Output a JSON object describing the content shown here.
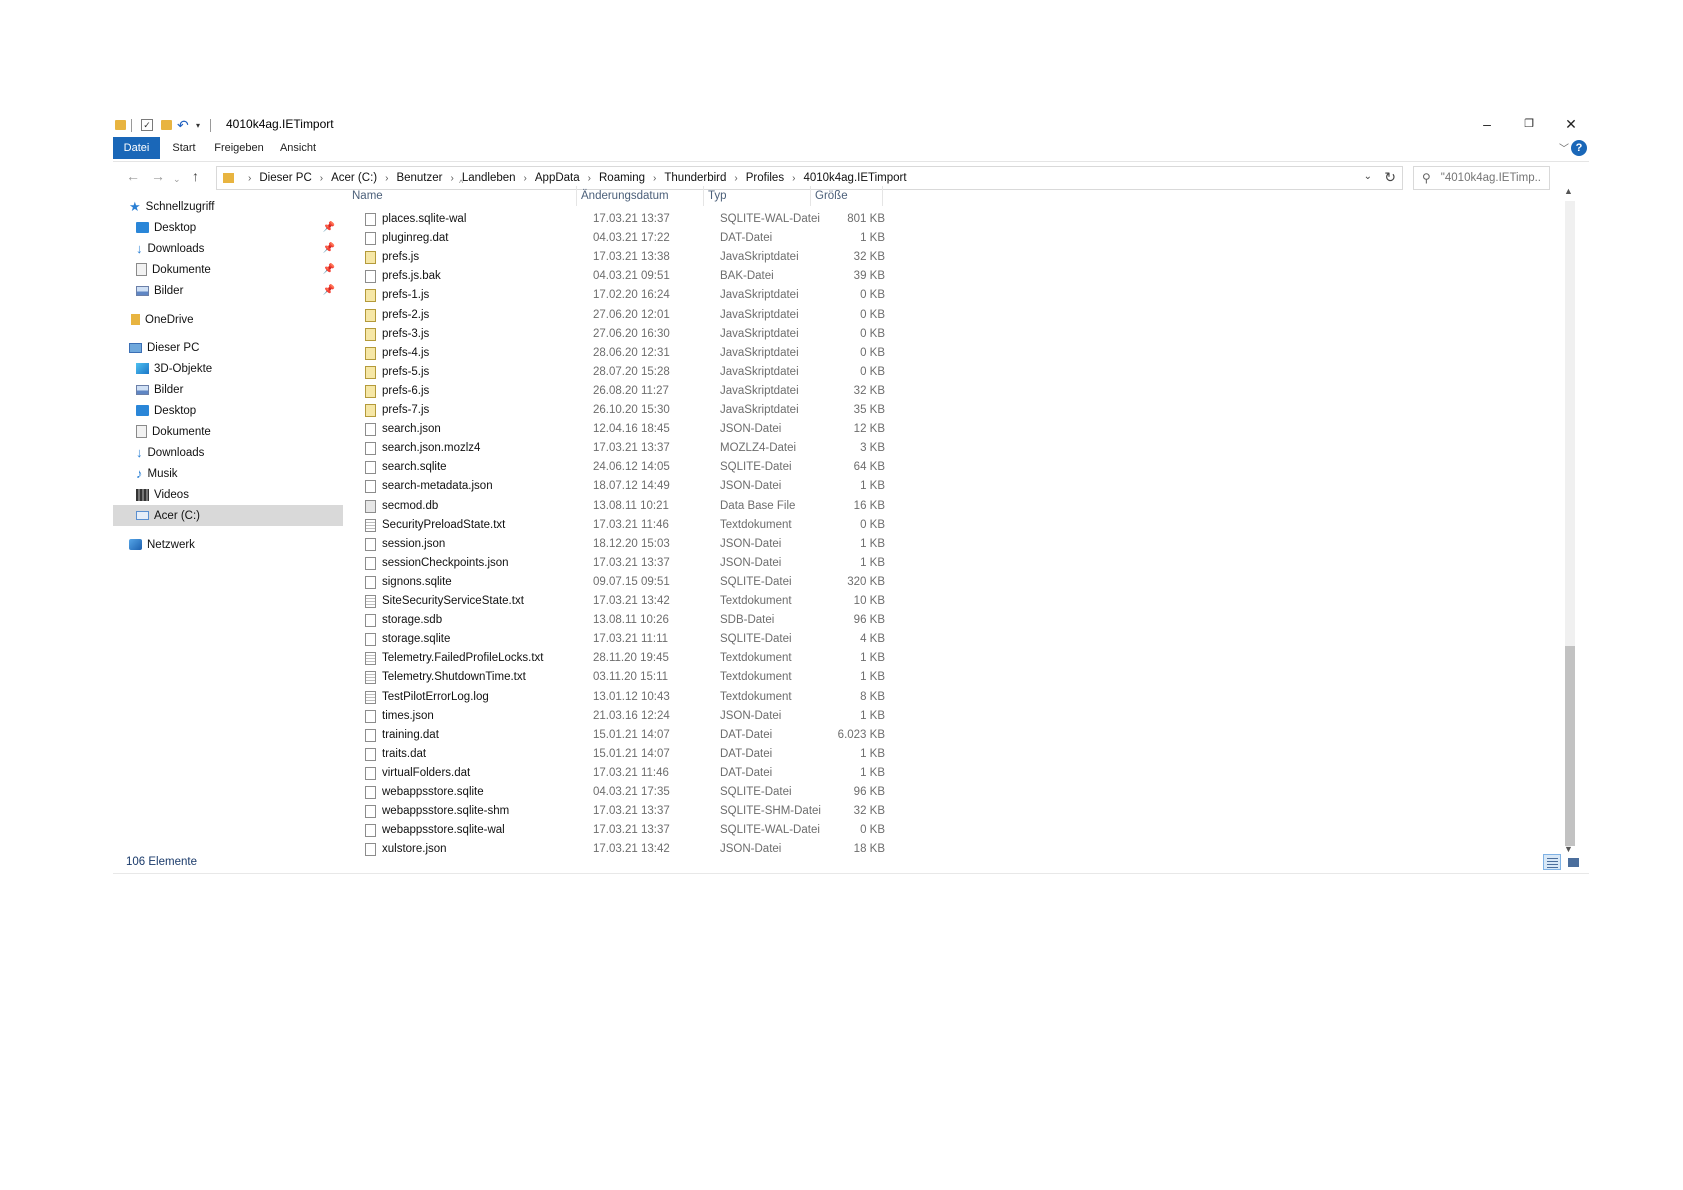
{
  "window": {
    "title": "4010k4ag.IETimport",
    "minimize_glyph": "–",
    "restore_glyph": "❐",
    "close_glyph": "✕"
  },
  "ribbon": {
    "tabs": [
      "Datei",
      "Start",
      "Freigeben",
      "Ansicht"
    ],
    "active_tab": "Datei",
    "help_label": "?"
  },
  "address": {
    "breadcrumbs": [
      "Dieser PC",
      "Acer (C:)",
      "Benutzer",
      "Landleben",
      "AppData",
      "Roaming",
      "Thunderbird",
      "Profiles",
      "4010k4ag.IETimport"
    ]
  },
  "search": {
    "placeholder": "\"4010k4ag.IETimp..."
  },
  "sidebar": {
    "quick_access": "Schnellzugriff",
    "quick_items": [
      "Desktop",
      "Downloads",
      "Dokumente",
      "Bilder"
    ],
    "onedrive": "OneDrive",
    "this_pc": "Dieser PC",
    "pc_items": [
      "3D-Objekte",
      "Bilder",
      "Desktop",
      "Dokumente",
      "Downloads",
      "Musik",
      "Videos",
      "Acer (C:)"
    ],
    "network": "Netzwerk",
    "selected": "Acer (C:)"
  },
  "columns": {
    "name": "Name",
    "date": "Änderungsdatum",
    "type": "Typ",
    "size": "Größe"
  },
  "files": [
    {
      "name": "places.sqlite-wal",
      "date": "17.03.21 13:37",
      "type": "SQLITE-WAL-Datei",
      "size": "801 KB",
      "icon": "file"
    },
    {
      "name": "pluginreg.dat",
      "date": "04.03.21 17:22",
      "type": "DAT-Datei",
      "size": "1 KB",
      "icon": "file"
    },
    {
      "name": "prefs.js",
      "date": "17.03.21 13:38",
      "type": "JavaSkriptdatei",
      "size": "32 KB",
      "icon": "js"
    },
    {
      "name": "prefs.js.bak",
      "date": "04.03.21 09:51",
      "type": "BAK-Datei",
      "size": "39 KB",
      "icon": "file"
    },
    {
      "name": "prefs-1.js",
      "date": "17.02.20 16:24",
      "type": "JavaSkriptdatei",
      "size": "0 KB",
      "icon": "js"
    },
    {
      "name": "prefs-2.js",
      "date": "27.06.20 12:01",
      "type": "JavaSkriptdatei",
      "size": "0 KB",
      "icon": "js"
    },
    {
      "name": "prefs-3.js",
      "date": "27.06.20 16:30",
      "type": "JavaSkriptdatei",
      "size": "0 KB",
      "icon": "js"
    },
    {
      "name": "prefs-4.js",
      "date": "28.06.20 12:31",
      "type": "JavaSkriptdatei",
      "size": "0 KB",
      "icon": "js"
    },
    {
      "name": "prefs-5.js",
      "date": "28.07.20 15:28",
      "type": "JavaSkriptdatei",
      "size": "0 KB",
      "icon": "js"
    },
    {
      "name": "prefs-6.js",
      "date": "26.08.20 11:27",
      "type": "JavaSkriptdatei",
      "size": "32 KB",
      "icon": "js"
    },
    {
      "name": "prefs-7.js",
      "date": "26.10.20 15:30",
      "type": "JavaSkriptdatei",
      "size": "35 KB",
      "icon": "js"
    },
    {
      "name": "search.json",
      "date": "12.04.16 18:45",
      "type": "JSON-Datei",
      "size": "12 KB",
      "icon": "file"
    },
    {
      "name": "search.json.mozlz4",
      "date": "17.03.21 13:37",
      "type": "MOZLZ4-Datei",
      "size": "3 KB",
      "icon": "file"
    },
    {
      "name": "search.sqlite",
      "date": "24.06.12 14:05",
      "type": "SQLITE-Datei",
      "size": "64 KB",
      "icon": "file"
    },
    {
      "name": "search-metadata.json",
      "date": "18.07.12 14:49",
      "type": "JSON-Datei",
      "size": "1 KB",
      "icon": "file"
    },
    {
      "name": "secmod.db",
      "date": "13.08.11 10:21",
      "type": "Data Base File",
      "size": "16 KB",
      "icon": "db"
    },
    {
      "name": "SecurityPreloadState.txt",
      "date": "17.03.21 11:46",
      "type": "Textdokument",
      "size": "0 KB",
      "icon": "txt"
    },
    {
      "name": "session.json",
      "date": "18.12.20 15:03",
      "type": "JSON-Datei",
      "size": "1 KB",
      "icon": "file"
    },
    {
      "name": "sessionCheckpoints.json",
      "date": "17.03.21 13:37",
      "type": "JSON-Datei",
      "size": "1 KB",
      "icon": "file"
    },
    {
      "name": "signons.sqlite",
      "date": "09.07.15 09:51",
      "type": "SQLITE-Datei",
      "size": "320 KB",
      "icon": "file"
    },
    {
      "name": "SiteSecurityServiceState.txt",
      "date": "17.03.21 13:42",
      "type": "Textdokument",
      "size": "10 KB",
      "icon": "txt"
    },
    {
      "name": "storage.sdb",
      "date": "13.08.11 10:26",
      "type": "SDB-Datei",
      "size": "96 KB",
      "icon": "file"
    },
    {
      "name": "storage.sqlite",
      "date": "17.03.21 11:11",
      "type": "SQLITE-Datei",
      "size": "4 KB",
      "icon": "file"
    },
    {
      "name": "Telemetry.FailedProfileLocks.txt",
      "date": "28.11.20 19:45",
      "type": "Textdokument",
      "size": "1 KB",
      "icon": "txt"
    },
    {
      "name": "Telemetry.ShutdownTime.txt",
      "date": "03.11.20 15:11",
      "type": "Textdokument",
      "size": "1 KB",
      "icon": "txt"
    },
    {
      "name": "TestPilotErrorLog.log",
      "date": "13.01.12 10:43",
      "type": "Textdokument",
      "size": "8 KB",
      "icon": "txt"
    },
    {
      "name": "times.json",
      "date": "21.03.16 12:24",
      "type": "JSON-Datei",
      "size": "1 KB",
      "icon": "file"
    },
    {
      "name": "training.dat",
      "date": "15.01.21 14:07",
      "type": "DAT-Datei",
      "size": "6.023 KB",
      "icon": "file"
    },
    {
      "name": "traits.dat",
      "date": "15.01.21 14:07",
      "type": "DAT-Datei",
      "size": "1 KB",
      "icon": "file"
    },
    {
      "name": "virtualFolders.dat",
      "date": "17.03.21 11:46",
      "type": "DAT-Datei",
      "size": "1 KB",
      "icon": "file"
    },
    {
      "name": "webappsstore.sqlite",
      "date": "04.03.21 17:35",
      "type": "SQLITE-Datei",
      "size": "96 KB",
      "icon": "file"
    },
    {
      "name": "webappsstore.sqlite-shm",
      "date": "17.03.21 13:37",
      "type": "SQLITE-SHM-Datei",
      "size": "32 KB",
      "icon": "file"
    },
    {
      "name": "webappsstore.sqlite-wal",
      "date": "17.03.21 13:37",
      "type": "SQLITE-WAL-Datei",
      "size": "0 KB",
      "icon": "file"
    },
    {
      "name": "xulstore.json",
      "date": "17.03.21 13:42",
      "type": "JSON-Datei",
      "size": "18 KB",
      "icon": "file"
    }
  ],
  "status": {
    "item_count": "106 Elemente"
  }
}
